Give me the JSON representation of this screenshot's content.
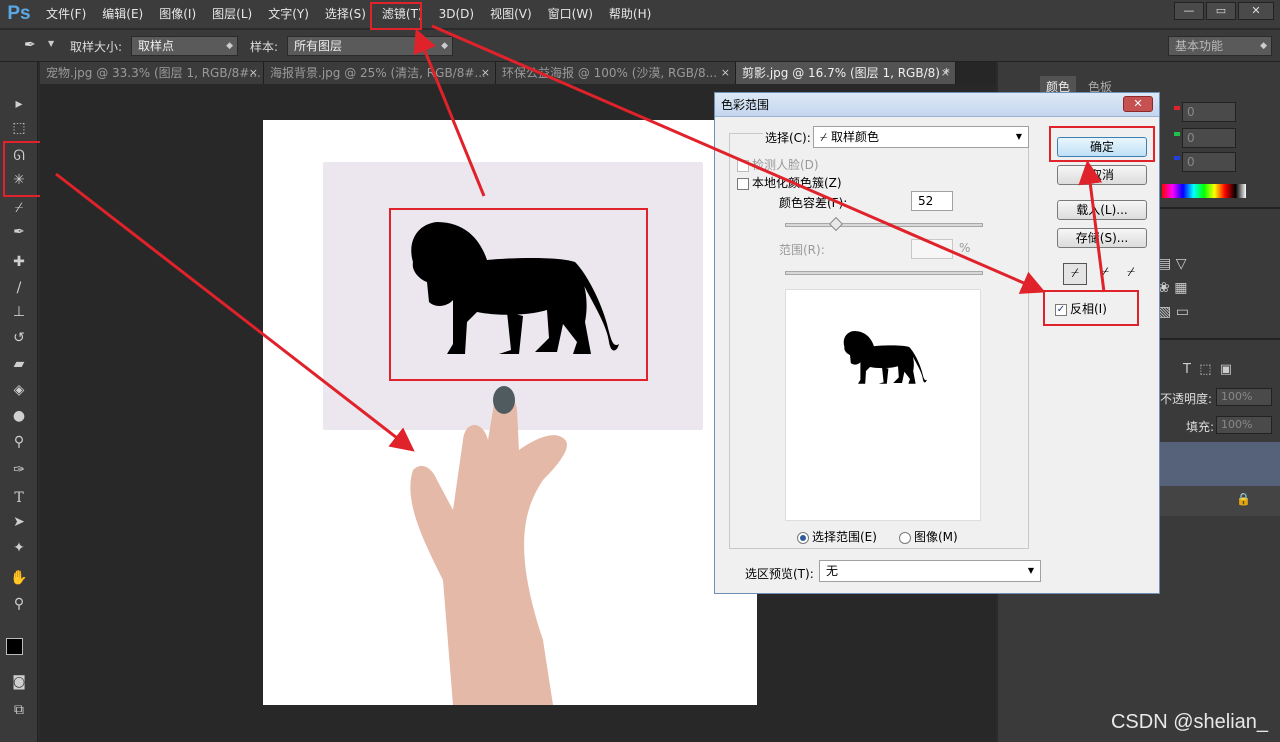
{
  "app": {
    "logo": "Ps"
  },
  "menu": [
    "文件(F)",
    "编辑(E)",
    "图像(I)",
    "图层(L)",
    "文字(Y)",
    "选择(S)",
    "滤镜(T)",
    "3D(D)",
    "视图(V)",
    "窗口(W)",
    "帮助(H)"
  ],
  "window_buttons": {
    "minimize": "—",
    "restore": "▭",
    "close": "✕"
  },
  "options": {
    "sample_size_label": "取样大小:",
    "sample_size_value": "取样点",
    "sample_label": "样本:",
    "sample_value": "所有图层",
    "workspace": "基本功能"
  },
  "tabs": [
    {
      "label": "宠物.jpg @ 33.3% (图层 1, RGB/8#..."
    },
    {
      "label": "海报背景.jpg @ 25% (清洁, RGB/8#..."
    },
    {
      "label": "环保公益海报 @ 100% (沙漠, RGB/8..."
    },
    {
      "label": "剪影.jpg @ 16.7% (图层 1, RGB/8) *"
    }
  ],
  "tab_close": "×",
  "dialog": {
    "title": "色彩范围",
    "close": "✕",
    "select_label": "选择(C):",
    "select_value": "取样颜色",
    "detect_faces": "检测人脸(D)",
    "localized": "本地化颜色簇(Z)",
    "fuzziness_label": "颜色容差(F):",
    "fuzziness_value": "52",
    "range_label": "范围(R):",
    "range_unit": "%",
    "radio_selection": "选择范围(E)",
    "radio_image": "图像(M)",
    "preview_label": "选区预览(T):",
    "preview_value": "无",
    "ok": "确定",
    "cancel": "取消",
    "load": "载入(L)...",
    "save": "存储(S)...",
    "invert": "反相(I)",
    "invert_mark": "✓"
  },
  "panels": {
    "color_tab": "颜色",
    "swatches_tab": "色板",
    "rgb_values": [
      "0",
      "0",
      "0"
    ],
    "opacity_label": "不透明度:",
    "opacity_value": "100%",
    "fill_label": "填充:",
    "fill_value": "100%"
  },
  "watermark": "CSDN @shelian_"
}
